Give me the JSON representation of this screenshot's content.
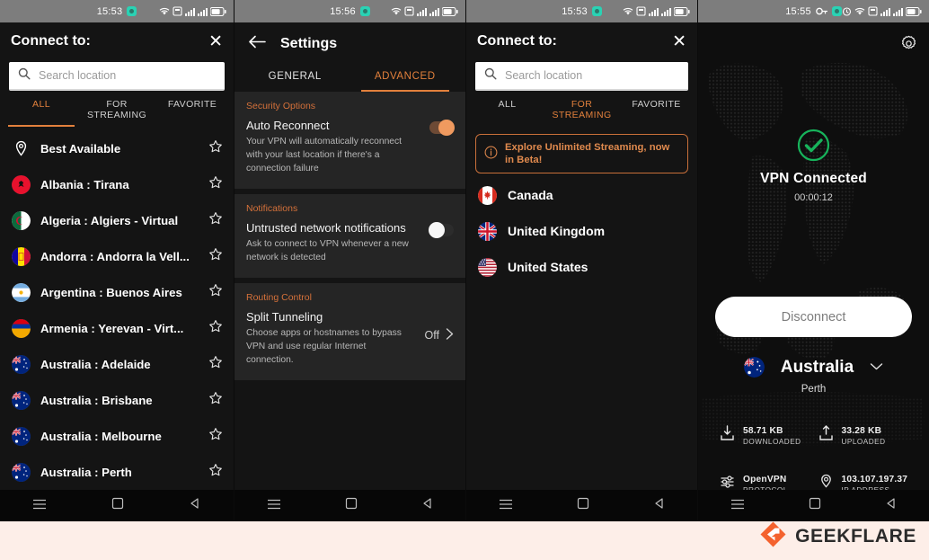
{
  "colors": {
    "accent_orange": "#e2803c",
    "panel_bg": "#141414",
    "section_bg": "#252525",
    "status_bar": "#7d7d7d",
    "connected_green": "#17b35b",
    "page_bg": "#fdeee8",
    "brand_orange": "#f4622e"
  },
  "panel1": {
    "statusbar": {
      "time": "15:53",
      "app_icon": "vpn-app-icon"
    },
    "header": {
      "title": "Connect to:",
      "close_icon": "close-icon"
    },
    "search": {
      "placeholder": "Search location",
      "value": "",
      "icon": "search-icon"
    },
    "tabs": [
      {
        "label": "ALL",
        "active": true
      },
      {
        "label": "FOR",
        "label2": "STREAMING",
        "active": false
      },
      {
        "label": "FAVORITE",
        "active": false
      }
    ],
    "locations": [
      {
        "name": "Best Available",
        "flag": "location-pin-icon"
      },
      {
        "name": "Albania : Tirana",
        "flag": "flag-albania"
      },
      {
        "name": "Algeria : Algiers - Virtual",
        "flag": "flag-algeria"
      },
      {
        "name": "Andorra : Andorra la Vell...",
        "flag": "flag-andorra"
      },
      {
        "name": "Argentina : Buenos Aires",
        "flag": "flag-argentina"
      },
      {
        "name": "Armenia : Yerevan - Virt...",
        "flag": "flag-armenia"
      },
      {
        "name": "Australia : Adelaide",
        "flag": "flag-australia"
      },
      {
        "name": "Australia : Brisbane",
        "flag": "flag-australia"
      },
      {
        "name": "Australia : Melbourne",
        "flag": "flag-australia"
      },
      {
        "name": "Australia : Perth",
        "flag": "flag-australia"
      }
    ]
  },
  "panel2": {
    "statusbar": {
      "time": "15:56"
    },
    "header": {
      "title": "Settings",
      "back_icon": "back-arrow-icon"
    },
    "tabs": [
      {
        "label": "GENERAL",
        "active": false
      },
      {
        "label": "ADVANCED",
        "active": true
      }
    ],
    "sections": [
      {
        "title": "Security Options",
        "option_name": "Auto Reconnect",
        "option_desc": "Your VPN will automatically reconnect with your last location if there's a connection failure",
        "toggle": "on"
      },
      {
        "title": "Notifications",
        "option_name": "Untrusted network notifications",
        "option_desc": "Ask to connect to VPN whenever a new network is detected",
        "toggle": "off"
      },
      {
        "title": "Routing Control",
        "option_name": "Split Tunneling",
        "option_desc": "Choose apps or hostnames to bypass VPN and use regular Internet connection.",
        "value": "Off",
        "chevron": "chevron-right-icon"
      }
    ]
  },
  "panel3": {
    "statusbar": {
      "time": "15:53"
    },
    "header": {
      "title": "Connect to:",
      "close_icon": "close-icon"
    },
    "search": {
      "placeholder": "Search location",
      "value": "",
      "icon": "search-icon"
    },
    "tabs": [
      {
        "label": "ALL",
        "active": false
      },
      {
        "label": "FOR",
        "label2": "STREAMING",
        "active": true
      },
      {
        "label": "FAVORITE",
        "active": false
      }
    ],
    "banner": {
      "text": "Explore Unlimited Streaming, now in Beta!",
      "icon": "info-icon"
    },
    "locations": [
      {
        "name": "Canada",
        "flag": "flag-canada"
      },
      {
        "name": "United Kingdom",
        "flag": "flag-uk"
      },
      {
        "name": "United States",
        "flag": "flag-usa"
      }
    ]
  },
  "panel4": {
    "statusbar": {
      "time": "15:55",
      "vpn_key_icon": "vpn-key-icon"
    },
    "gear_icon": "gear-icon",
    "status": {
      "icon": "check-circle-icon",
      "title": "VPN Connected",
      "timer": "00:00:12"
    },
    "disconnect_label": "Disconnect",
    "server": {
      "country": "Australia",
      "city": "Perth",
      "flag": "flag-australia",
      "chevron": "chevron-down-icon"
    },
    "stats": [
      {
        "value": "58.71 KB",
        "label": "DOWNLOADED",
        "icon": "download-icon"
      },
      {
        "value": "33.28 KB",
        "label": "UPLOADED",
        "icon": "upload-icon"
      },
      {
        "value": "OpenVPN",
        "label": "PROTOCOL",
        "icon": "protocol-icon"
      },
      {
        "value": "103.107.197.37",
        "label": "IP ADDRESS",
        "icon": "location-pin-icon"
      }
    ]
  },
  "navbar": {
    "menu_icon": "menu-icon",
    "home_icon": "home-square-icon",
    "back_icon": "back-triangle-icon"
  },
  "watermark": {
    "text": "GEEKFLARE",
    "logo": "geekflare-logo-icon"
  }
}
